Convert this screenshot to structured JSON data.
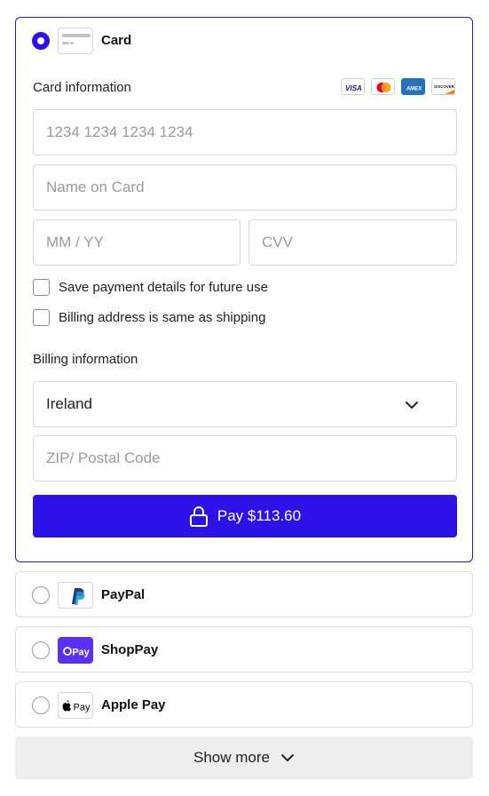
{
  "colors": {
    "accent": "#2d12e8",
    "border": "#d7d7d7",
    "placeholder": "#9b9b9b"
  },
  "card_method": {
    "label": "Card",
    "selected": true,
    "card_information_label": "Card information",
    "brands": [
      "visa-icon",
      "mastercard-icon",
      "amex-icon",
      "discover-icon"
    ],
    "brand_text": {
      "visa": "VISA",
      "amex": "AMEX",
      "discover": "DISCOVER"
    },
    "card_number_placeholder": "1234 1234 1234 1234",
    "name_placeholder": "Name on Card",
    "expiry_placeholder": "MM / YY",
    "cvv_placeholder": "CVV",
    "save_details_label": "Save payment details for future use",
    "billing_same_label": "Billing address is same as shipping",
    "billing_information_label": "Billing information",
    "country_value": "Ireland",
    "zip_placeholder": "ZIP/ Postal Code",
    "pay_button_label": "Pay $113.60"
  },
  "other_methods": [
    {
      "label": "PayPal",
      "icon": "paypal-icon"
    },
    {
      "label": "ShopPay",
      "icon": "shoppay-icon",
      "logo_text": "Pay"
    },
    {
      "label": "Apple Pay",
      "icon": "apple-pay-icon",
      "logo_text": "Pay"
    }
  ],
  "show_more_label": "Show more"
}
